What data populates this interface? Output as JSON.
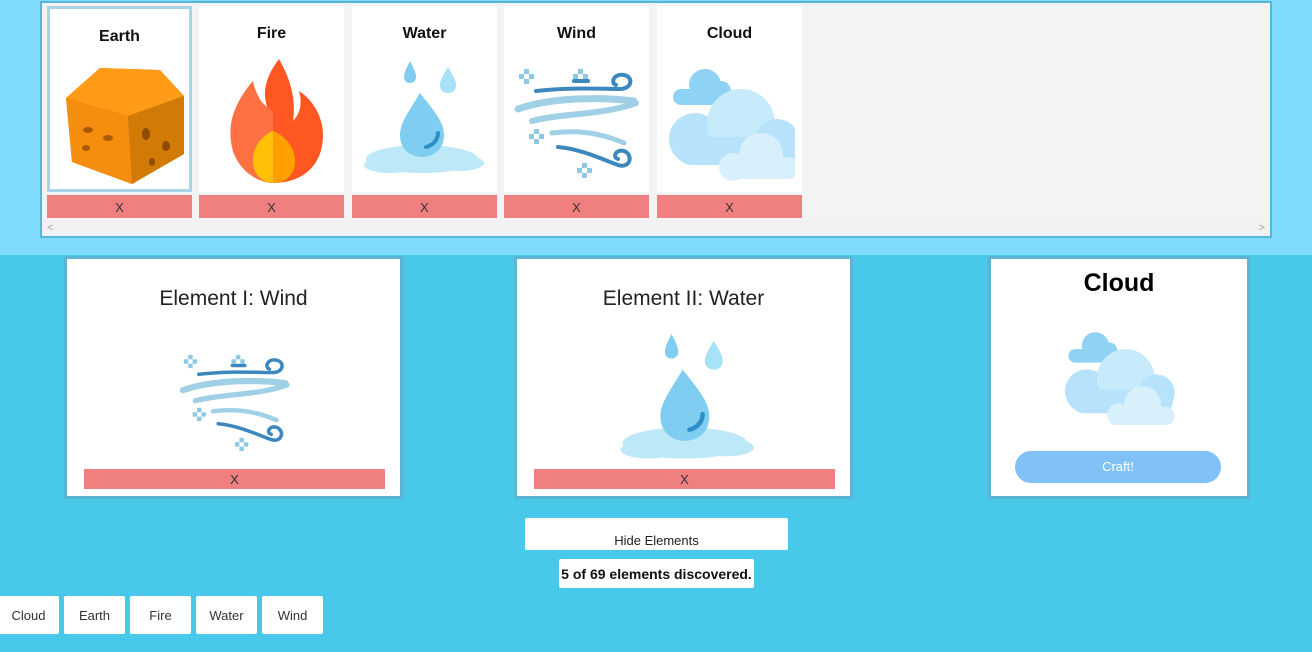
{
  "element_bar": {
    "cards": [
      {
        "name": "Earth",
        "icon": "earth-cube-icon",
        "remove_label": "X",
        "selected": true
      },
      {
        "name": "Fire",
        "icon": "fire-icon",
        "remove_label": "X"
      },
      {
        "name": "Water",
        "icon": "water-drop-icon",
        "remove_label": "X"
      },
      {
        "name": "Wind",
        "icon": "wind-icon",
        "remove_label": "X"
      },
      {
        "name": "Cloud",
        "icon": "cloud-icon",
        "remove_label": "X"
      }
    ],
    "scroll_left": "<",
    "scroll_right": ">"
  },
  "slot1": {
    "title": "Element I: Wind",
    "icon": "wind-icon",
    "remove_label": "X"
  },
  "slot2": {
    "title": "Element II: Water",
    "icon": "water-drop-icon",
    "remove_label": "X"
  },
  "result": {
    "name": "Cloud",
    "icon": "cloud-icon",
    "craft_label": "Craft!"
  },
  "hide_button": "Hide Elements",
  "discovered_text": "5 of 69 elements discovered.",
  "discovered_list": [
    "Cloud",
    "Earth",
    "Fire",
    "Water",
    "Wind"
  ],
  "colors": {
    "top_band": "#80dcfc",
    "background": "#48c9ea",
    "remove_bar": "#f08080",
    "craft_button": "#80c2f8"
  }
}
